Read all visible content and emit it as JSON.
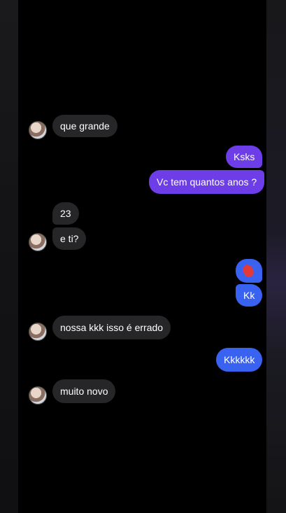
{
  "messages": [
    {
      "id": "m1",
      "text": "que grande"
    },
    {
      "id": "m2",
      "text": "Ksks"
    },
    {
      "id": "m3",
      "text": "Vc tem quantos anos ?"
    },
    {
      "id": "m4",
      "text": "23"
    },
    {
      "id": "m5",
      "text": "e ti?"
    },
    {
      "id": "m6",
      "text": "Kk"
    },
    {
      "id": "m7",
      "text": "nossa kkk isso é errado"
    },
    {
      "id": "m8",
      "text": "Kkkkkk"
    },
    {
      "id": "m9",
      "text": "muito novo"
    }
  ],
  "colors": {
    "incoming_bubble": "#262628",
    "outgoing_purple": "#6d3de8",
    "outgoing_blue": "#3a62f0",
    "background": "#000000"
  },
  "icons": {
    "avatar": "contact-avatar-icon",
    "reaction": "heart-emoji-icon"
  }
}
